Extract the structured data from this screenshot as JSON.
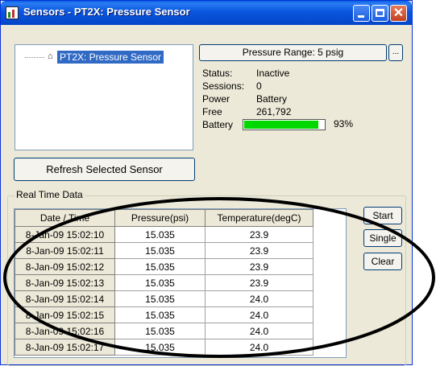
{
  "window": {
    "title": "Sensors - PT2X: Pressure Sensor",
    "controls": {
      "minimize_icon": "minimize-icon",
      "maximize_icon": "maximize-icon",
      "close_icon": "close-icon",
      "close_glyph": "✕"
    }
  },
  "tree": {
    "node_label": "PT2X: Pressure Sensor",
    "node_icon": "⌂"
  },
  "refresh_button": "Refresh Selected Sensor",
  "pressure_range_button": "Pressure Range: 5 psig",
  "more_button": "...",
  "status": {
    "status_label": "Status:",
    "status_value": "Inactive",
    "sessions_label": "Sessions:",
    "sessions_value": "0",
    "power_label": "Power",
    "power_value": "Battery",
    "free_label": "Free",
    "free_value": "261,792",
    "battery_label": "Battery",
    "battery_percent_text": "93%",
    "battery_level": 0.93
  },
  "realtime": {
    "group_title": "Real Time Data",
    "columns": [
      "Date / Time",
      "Pressure(psi)",
      "Temperature(degC)"
    ],
    "rows": [
      [
        "8-Jan-09 15:02:10",
        "15.035",
        "23.9"
      ],
      [
        "8-Jan-09 15:02:11",
        "15.035",
        "23.9"
      ],
      [
        "8-Jan-09 15:02:12",
        "15.035",
        "23.9"
      ],
      [
        "8-Jan-09 15:02:13",
        "15.035",
        "23.9"
      ],
      [
        "8-Jan-09 15:02:14",
        "15.035",
        "24.0"
      ],
      [
        "8-Jan-09 15:02:15",
        "15.035",
        "24.0"
      ],
      [
        "8-Jan-09 15:02:16",
        "15.035",
        "24.0"
      ],
      [
        "8-Jan-09 15:02:17",
        "15.035",
        "24.0"
      ]
    ]
  },
  "buttons": {
    "start": "Start",
    "single": "Single",
    "clear": "Clear"
  },
  "colors": {
    "titlebar": "#0a56de",
    "selection": "#316ac5",
    "battery_fill": "#00d800",
    "window_bg": "#ece9d8"
  }
}
